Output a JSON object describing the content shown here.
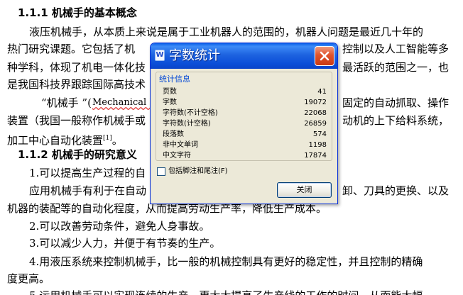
{
  "document": {
    "heading_1": "1.1.1  机械手的基本概念",
    "para1_l1": "液压机械手，从本质上来说是属于工业机器人的范围的，机器人问题是最近几十年的",
    "para1_l2a": "热门研究课题。它包括了机",
    "para1_l2b": "控制以及人工智能等多",
    "para1_l3a": "种学科，体现了机电一体化技",
    "para1_l3b": "最活跃的范围之一，也",
    "para1_l4a": "是我国科技界跟踪国际高技术",
    "para2_l1a": "“机械手 ”(",
    "para2_l1b": "Mechanical I",
    "para2_l1c": "固定的自动抓取、操作",
    "para2_l2a": "装置（我国一般称作机械手或",
    "para2_l2b": "动机的上下给料系统，",
    "para2_l3": "加工中心自动化装置",
    "para2_ref": "[1]",
    "para2_end": "。",
    "heading_2": "1.1.2  机械手的研究意义",
    "item1": "1.可以提高生产过程的自",
    "para3_l1a": "应用机械手有利于在自动",
    "para3_l1b": "卸、刀具的更换、以及",
    "para3_l2": "机器的装配等的自动化程度，从而提高劳动生产率，降低生产成本。",
    "item2": "2.可以改善劳动条件，避免人身事故。",
    "item3": "3.可以减少人力，并便于有节奏的生产。",
    "item4_l1": "4.用液压系统来控制机械手，比一般的机械控制具有更好的稳定性，并且控制的精确",
    "item4_l2": "度更高。",
    "item5": "5.运用机械手可以实现连续的生产，更大大提高了生产线的工作的时间，从而能大幅"
  },
  "dialog": {
    "icon_glyph": "W",
    "title": "字数统计",
    "group_label": "统计信息",
    "stats": [
      {
        "label": "页数",
        "value": "41"
      },
      {
        "label": "字数",
        "value": "19072"
      },
      {
        "label": "字符数(不计空格)",
        "value": "22068"
      },
      {
        "label": "字符数(计空格)",
        "value": "26859"
      },
      {
        "label": "段落数",
        "value": "574"
      },
      {
        "label": "非中文单词",
        "value": "1198"
      },
      {
        "label": "中文字符",
        "value": "17874"
      }
    ],
    "checkbox_label": "包括脚注和尾注(F)",
    "checkbox_checked": false,
    "close_button": "关闭"
  }
}
